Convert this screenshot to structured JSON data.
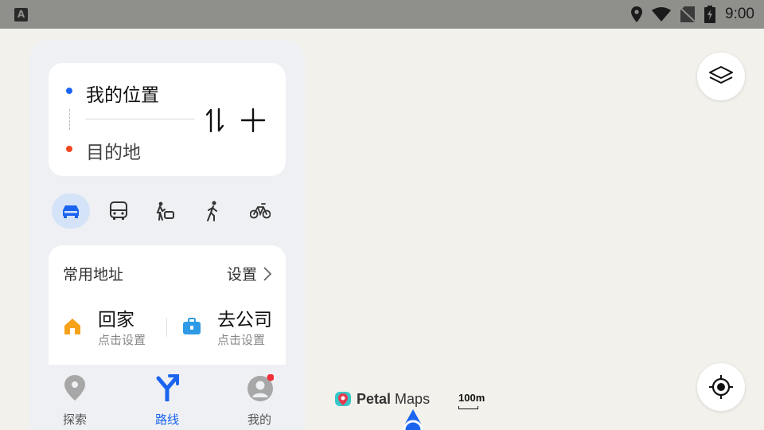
{
  "status_bar": {
    "time": "9:00",
    "left_icon": "A"
  },
  "route": {
    "origin": "我的位置",
    "destination": "目的地",
    "origin_color": "#1a64f0",
    "destination_color": "#f0461e"
  },
  "modes": [
    {
      "name": "car-icon",
      "selected": true
    },
    {
      "name": "bus-icon",
      "selected": false
    },
    {
      "name": "taxi-icon",
      "selected": false
    },
    {
      "name": "walk-icon",
      "selected": false
    },
    {
      "name": "bike-icon",
      "selected": false
    }
  ],
  "frequent": {
    "title": "常用地址",
    "settings": "设置",
    "home": {
      "name": "回家",
      "sub": "点击设置"
    },
    "work": {
      "name": "去公司",
      "sub": "点击设置"
    }
  },
  "nav": {
    "explore": "探索",
    "route": "路线",
    "mine": "我的"
  },
  "map": {
    "brand_bold": "Petal",
    "brand_light": "Maps",
    "scale": "100m"
  },
  "colors": {
    "accent": "#1a64f0",
    "panel_bg": "#eef0f3",
    "map_bg": "#f2f1ec"
  }
}
